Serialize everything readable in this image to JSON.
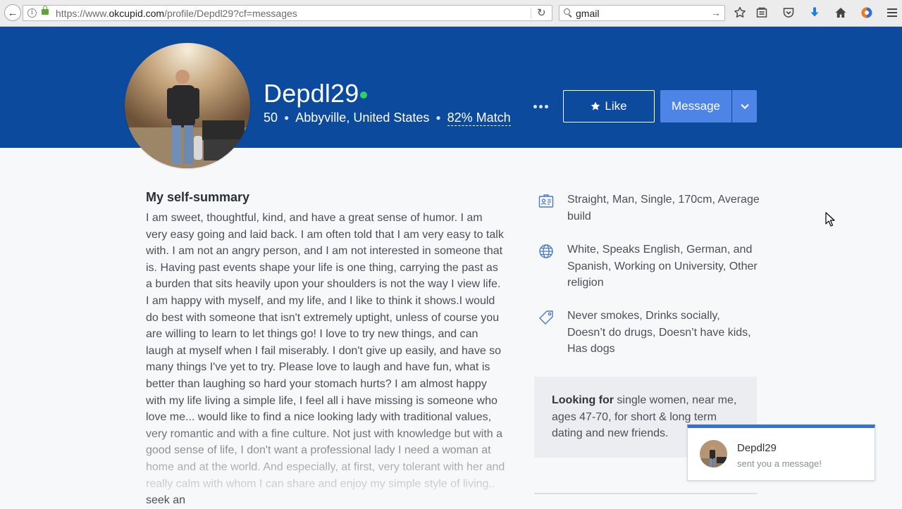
{
  "browser": {
    "url_prefix": "https://www.",
    "url_domain": "okcupid.com",
    "url_path": "/profile/Depdl29?cf=messages",
    "search_value": "gmail"
  },
  "profile": {
    "username": "Depdl29",
    "online": true,
    "age": "50",
    "location": "Abbyville, United States",
    "match": "82% Match",
    "like_label": "Like",
    "message_label": "Message"
  },
  "summary": {
    "title": "My self-summary",
    "body": "I am sweet, thoughtful, kind, and have a great sense of humor. I am very easy going and laid back. I am often told that I am very easy to talk with. I am not an angry person, and I am not interested in someone that is. Having past events shape your life is one thing, carrying the past as a burden that sits heavily upon your shoulders is not the way I view life. I am happy with myself, and my life, and I like to think it shows.I would do best with someone that isn't extremely uptight, unless of course you are willing to learn to let things go! I love to try new things, and can laugh at myself when I fail miserably. I don't give up easily, and have so many things I've yet to try. Please love to laugh and have fun, what is better than laughing so hard your stomach hurts? I am almost happy with my life living a simple life, I feel all i have missing is someone who love me... would like to find a nice looking lady with traditional values, very romantic and with a fine culture. Not just with knowledge but with a good sense of life, I don't want a professional lady I need a woman at home and at the world. And especially, at first, very tolerant with her and really calm with whom I can share and enjoy my simple style of living.. seek an"
  },
  "details": {
    "basics": "Straight, Man, Single, 170cm, Average build",
    "background": "White, Speaks English, German, and Spanish, Working on University, Other religion",
    "lifestyle": "Never smokes, Drinks socially, Doesn’t do drugs, Doesn’t have kids, Has dogs"
  },
  "looking_for": {
    "label": "Looking for",
    "text": " single women, near me, ages 47-70, for short & long term dating and new friends."
  },
  "notification": {
    "name": "Depdl29",
    "message": "sent you a message!"
  },
  "colors": {
    "header_bg": "#0c4a9e",
    "message_button": "#4d84e6",
    "online": "#2fd068",
    "notification_accent": "#3a6fd8"
  }
}
